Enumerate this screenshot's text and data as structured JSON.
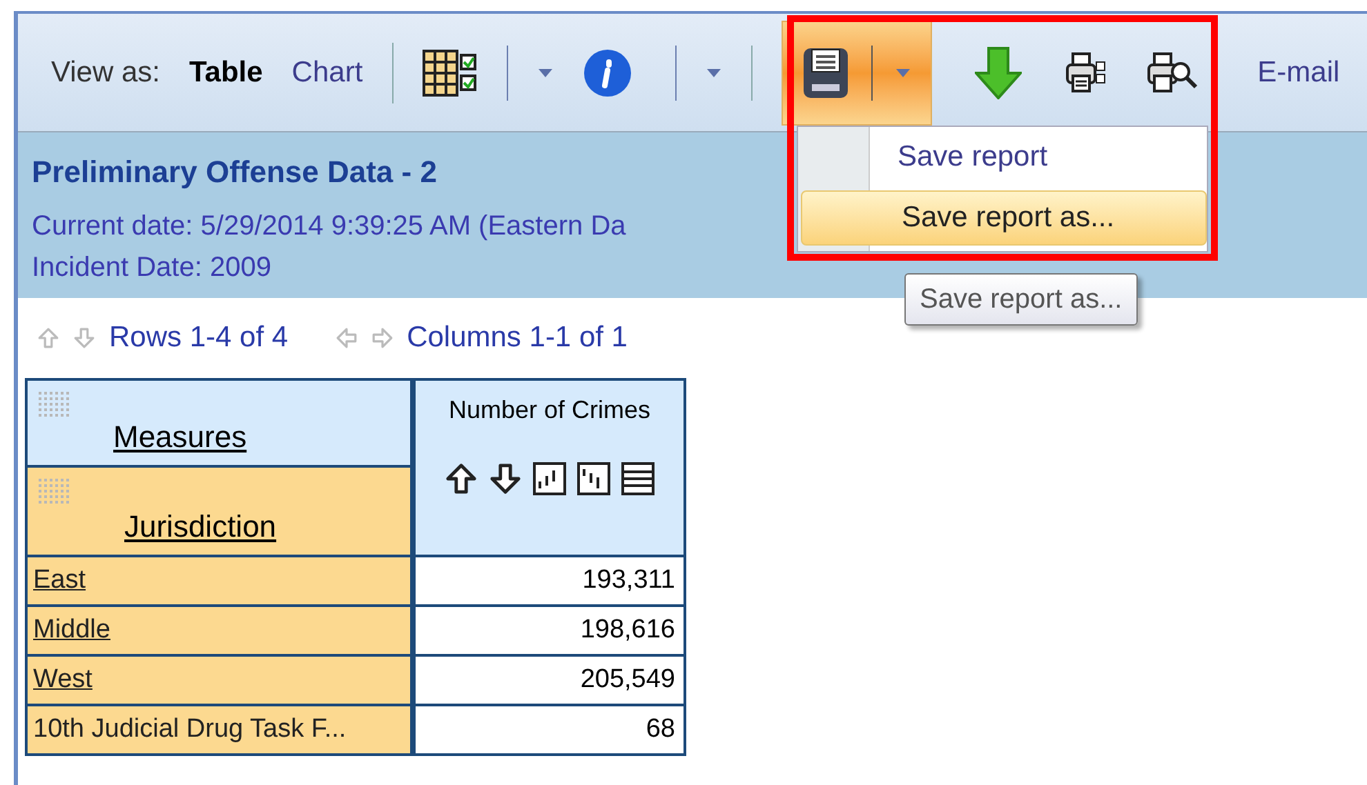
{
  "toolbar": {
    "view_as_label": "View as:",
    "views": [
      {
        "label": "Table",
        "selected": true
      },
      {
        "label": "Chart",
        "selected": false
      }
    ],
    "email_label": "E-mail"
  },
  "save_menu": {
    "items": [
      {
        "label": "Save report",
        "highlighted": false
      },
      {
        "label": "Save report as...",
        "highlighted": true
      }
    ],
    "tooltip": "Save report as..."
  },
  "report": {
    "title": "Preliminary Offense Data - 2",
    "current_date": "Current date: 5/29/2014 9:39:25 AM (Eastern Da",
    "incident_date": "Incident Date: 2009"
  },
  "paging": {
    "rows": "Rows 1-4 of 4",
    "columns": "Columns 1-1 of 1"
  },
  "table": {
    "measures_header": "Measures",
    "dimension_header": "Jurisdiction",
    "column_header": "Number of Crimes",
    "rows": [
      {
        "label": "East",
        "link": true,
        "value": "193,311"
      },
      {
        "label": "Middle",
        "link": true,
        "value": "198,616"
      },
      {
        "label": "West",
        "link": true,
        "value": "205,549"
      },
      {
        "label": "10th Judicial Drug Task F...",
        "link": false,
        "value": "68"
      }
    ]
  }
}
